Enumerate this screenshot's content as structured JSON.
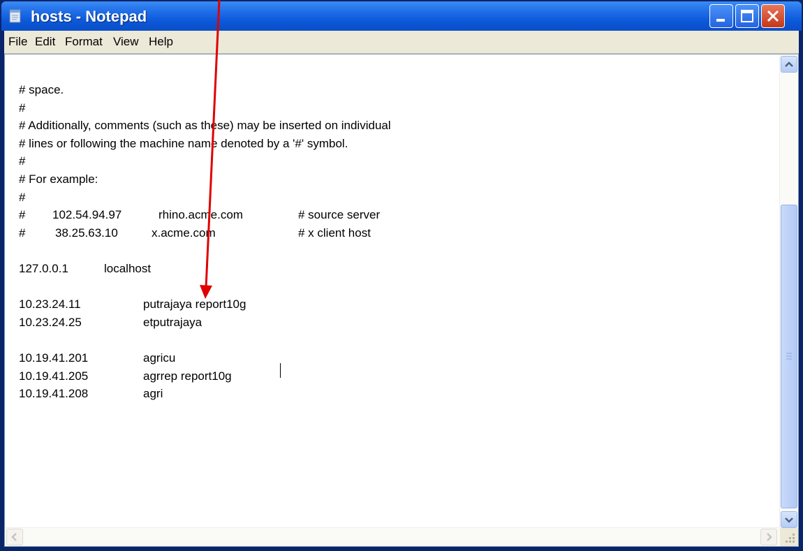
{
  "window": {
    "title": "hosts - Notepad",
    "colors": {
      "titlebar": "#0a57d8",
      "menubar": "#ece9d8",
      "close": "#c5361a",
      "annotation_arrow": "#e00000"
    }
  },
  "menu": [
    "File",
    "Edit",
    "Format",
    "View",
    "Help"
  ],
  "editor": {
    "lines": [
      {
        "c1": "# space.",
        "c2": "",
        "c3": ""
      },
      {
        "c1": "#",
        "c2": "",
        "c3": ""
      },
      {
        "c1": "# Additionally, comments (such as these) may be inserted on individual",
        "c2": "",
        "c3": ""
      },
      {
        "c1": "# lines or following the machine name denoted by a '#' symbol.",
        "c2": "",
        "c3": ""
      },
      {
        "c1": "#",
        "c2": "",
        "c3": ""
      },
      {
        "c1": "# For example:",
        "c2": "",
        "c3": ""
      },
      {
        "c1": "#",
        "c2": "",
        "c3": ""
      },
      {
        "c1": "#",
        "c2": "102.54.94.97",
        "c3": "rhino.acme.com",
        "c4": "# source server"
      },
      {
        "c1": "#",
        "c2": "38.25.63.10",
        "c3": "x.acme.com",
        "c4": "# x client host"
      },
      {
        "c1": "",
        "c2": "",
        "c3": ""
      },
      {
        "c1": "127.0.0.1",
        "c2": "",
        "c3": "localhost"
      },
      {
        "c1": "",
        "c2": "",
        "c3": ""
      },
      {
        "c1": "10.23.24.11",
        "c2": "",
        "c3": "putrajaya report10g"
      },
      {
        "c1": "10.23.24.25",
        "c2": "",
        "c3": "etputrajaya"
      },
      {
        "c1": "",
        "c2": "",
        "c3": ""
      },
      {
        "c1": "10.19.41.201",
        "c2": "",
        "c3": "agricu"
      },
      {
        "c1": "10.19.41.205",
        "c2": "",
        "c3": "agrrep report10g"
      },
      {
        "c1": "10.19.41.208",
        "c2": "",
        "c3": "agri"
      }
    ]
  },
  "icons": {
    "app": "notepad-icon",
    "minimize": "minimize-icon",
    "maximize": "maximize-icon",
    "close": "close-icon"
  }
}
